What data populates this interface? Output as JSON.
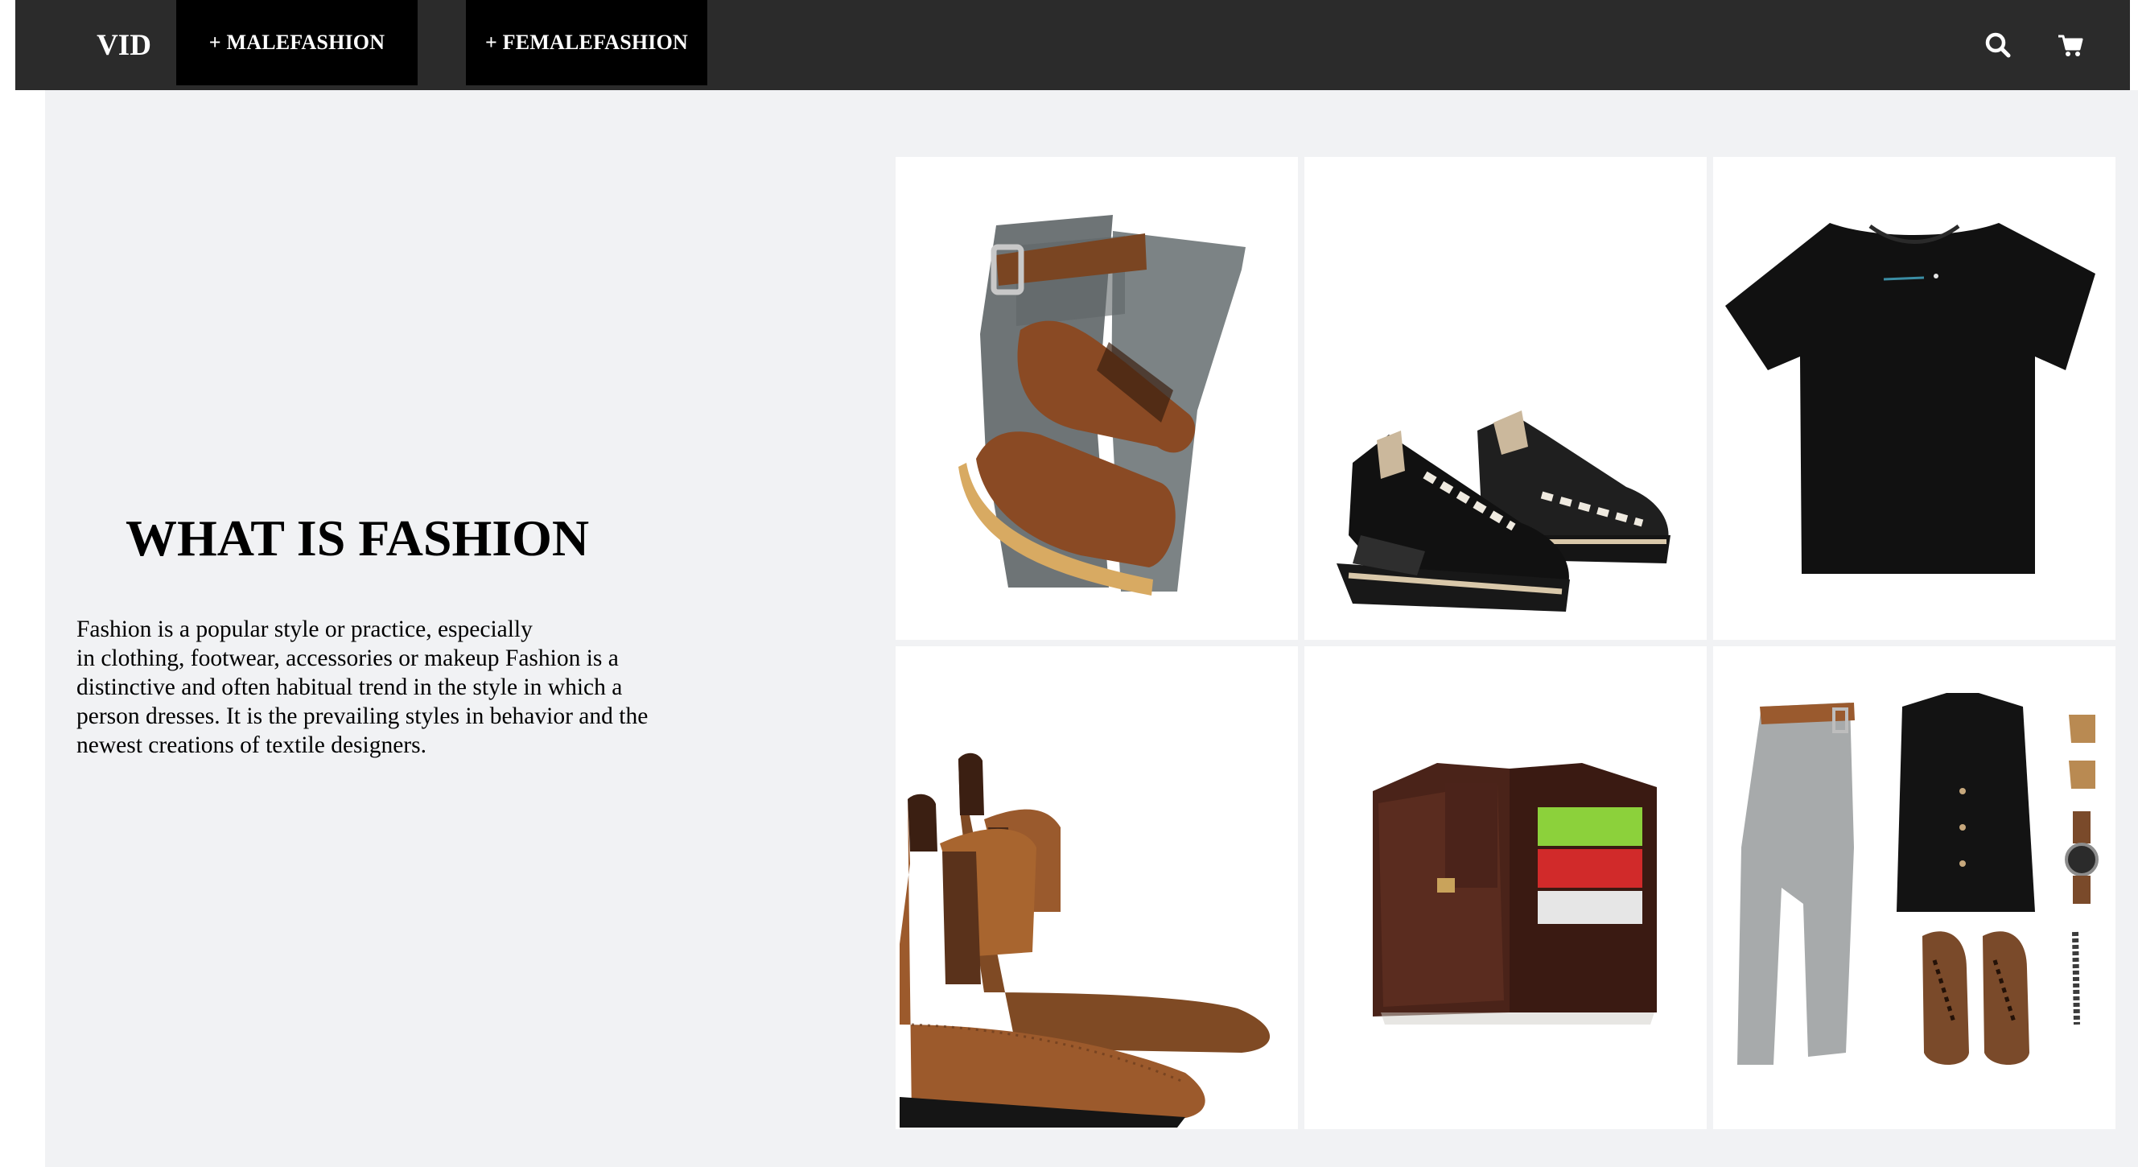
{
  "nav": {
    "brand": "VID",
    "male_label": "+ MALEFASHION",
    "female_label": "+ FEMALEFASHION",
    "icons": [
      "search-icon",
      "cart-icon"
    ]
  },
  "hero": {
    "title": "WHAT IS FASHION",
    "lines": [
      "Fashion is a popular style or practice, especially",
      "in clothing, footwear, accessories or makeup Fashion is a",
      "distinctive and often habitual trend in the style in which a",
      "person dresses. It is the prevailing styles in behavior and the",
      "newest creations of textile designers."
    ]
  },
  "colors": {
    "navbar": "#2b2b2b",
    "nav_button": "#000000",
    "page_background": "#f1f2f4",
    "tile_background": "#ffffff"
  },
  "products": [
    "jeans-belt-boots-image",
    "black-sneakers-image",
    "black-tshirt-image",
    "chelsea-boots-image",
    "leather-wallet-image",
    "outfit-flatlay-image"
  ]
}
